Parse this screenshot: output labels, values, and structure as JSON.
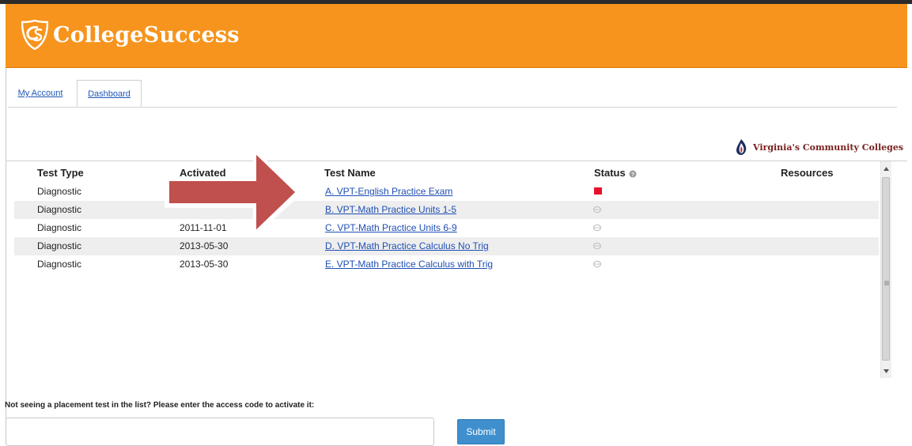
{
  "header": {
    "brand": "CollegeSuccess",
    "brand_color": "#f7941d",
    "logo_icon": "cs-shield-icon"
  },
  "tabs": [
    {
      "label": "My Account",
      "active": false
    },
    {
      "label": "Dashboard",
      "active": true
    }
  ],
  "partner": {
    "name": "Virginia's Community Colleges",
    "icon": "vcc-flame-icon"
  },
  "table": {
    "columns": [
      "Test Type",
      "Activated",
      "Test Name",
      "Status",
      "Resources"
    ],
    "status_help_icon": "info-icon",
    "rows": [
      {
        "test_type": "Diagnostic",
        "activated": "",
        "test_name": "A. VPT-English Practice Exam",
        "status": "red-square-icon"
      },
      {
        "test_type": "Diagnostic",
        "activated": "",
        "test_name": "B. VPT-Math Practice Units 1-5",
        "status": "gray-status-icon"
      },
      {
        "test_type": "Diagnostic",
        "activated": "2011-11-01",
        "test_name": "C. VPT-Math Practice Units 6-9",
        "status": "gray-status-icon"
      },
      {
        "test_type": "Diagnostic",
        "activated": "2013-05-30",
        "test_name": "D. VPT-Math Practice Calculus No Trig",
        "status": "gray-status-icon"
      },
      {
        "test_type": "Diagnostic",
        "activated": "2013-05-30",
        "test_name": "E. VPT-Math Practice Calculus with Trig",
        "status": "gray-status-icon"
      }
    ]
  },
  "activation": {
    "prompt": "Not seeing a placement test in the list? Please enter the access code to activate it:",
    "input_value": "",
    "input_placeholder": "",
    "submit_label": "Submit"
  },
  "annotation": {
    "icon": "red-arrow-icon",
    "color": "#c0504d"
  }
}
